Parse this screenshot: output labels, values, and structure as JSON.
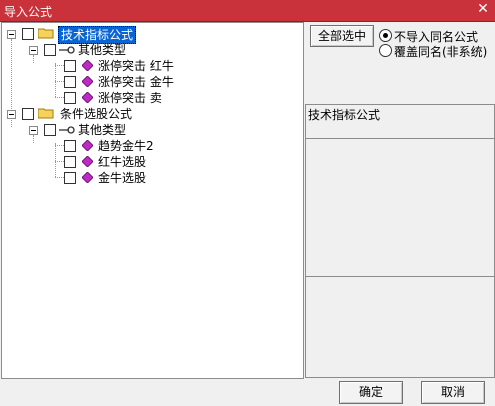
{
  "window": {
    "title": "导入公式",
    "close_glyph": "✕"
  },
  "tree": {
    "groups": [
      {
        "label": "技术指标公式",
        "selected": true,
        "subgroup": {
          "label": "其他类型",
          "items": [
            "涨停突击 红牛",
            "涨停突击 金牛",
            "涨停突击 卖"
          ]
        }
      },
      {
        "label": "条件选股公式",
        "selected": false,
        "subgroup": {
          "label": "其他类型",
          "items": [
            "趋势金牛2",
            "红牛选股",
            "金牛选股"
          ]
        }
      }
    ]
  },
  "options": {
    "select_all_label": "全部选中",
    "radio_no_import": "不导入同名公式",
    "radio_overwrite": "覆盖同名(非系统)",
    "selected_radio": "no_import"
  },
  "info": {
    "header": "技术指标公式"
  },
  "buttons": {
    "ok": "确定",
    "cancel": "取消"
  },
  "colors": {
    "title_bar": "#c9323a",
    "selection": "#0a64d2",
    "folder": "#f5d35b",
    "formula_icon": "#c028c8"
  },
  "icons": {
    "group": "folder-icon",
    "subgroup": "key-icon",
    "item": "formula-diamond-icon"
  }
}
